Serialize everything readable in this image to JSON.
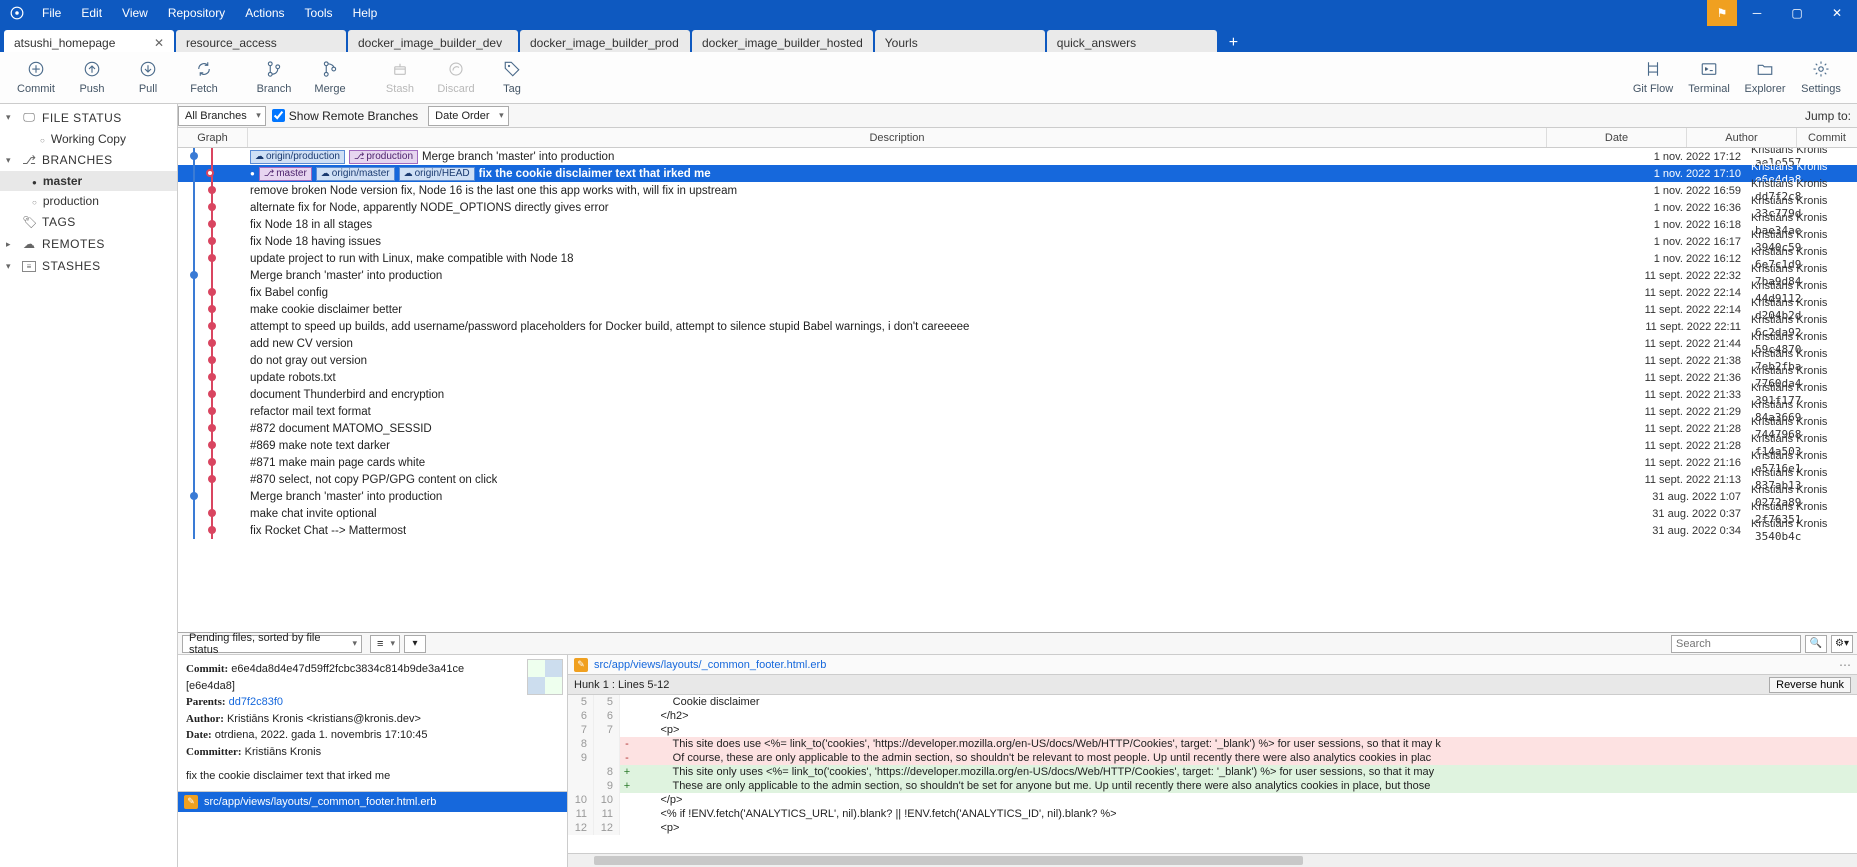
{
  "menu": [
    "File",
    "Edit",
    "View",
    "Repository",
    "Actions",
    "Tools",
    "Help"
  ],
  "tabs": [
    {
      "label": "atsushi_homepage",
      "active": true,
      "closable": true
    },
    {
      "label": "resource_access"
    },
    {
      "label": "docker_image_builder_dev"
    },
    {
      "label": "docker_image_builder_prod"
    },
    {
      "label": "docker_image_builder_hosted"
    },
    {
      "label": "Yourls"
    },
    {
      "label": "quick_answers"
    }
  ],
  "toolbar": [
    {
      "name": "commit",
      "label": "Commit",
      "icon": "plus"
    },
    {
      "name": "push",
      "label": "Push",
      "icon": "up"
    },
    {
      "name": "pull",
      "label": "Pull",
      "icon": "down"
    },
    {
      "name": "fetch",
      "label": "Fetch",
      "icon": "refresh"
    },
    {
      "sep": true
    },
    {
      "name": "branch",
      "label": "Branch",
      "icon": "branch"
    },
    {
      "name": "merge",
      "label": "Merge",
      "icon": "merge"
    },
    {
      "sep": true
    },
    {
      "name": "stash",
      "label": "Stash",
      "icon": "stash",
      "disabled": true
    },
    {
      "name": "discard",
      "label": "Discard",
      "icon": "discard",
      "disabled": true
    },
    {
      "name": "tag",
      "label": "Tag",
      "icon": "tag"
    }
  ],
  "toolbar_right": [
    {
      "name": "gitflow",
      "label": "Git Flow",
      "icon": "flow"
    },
    {
      "name": "terminal",
      "label": "Terminal",
      "icon": "term"
    },
    {
      "name": "explorer",
      "label": "Explorer",
      "icon": "folder"
    },
    {
      "name": "settings",
      "label": "Settings",
      "icon": "gear"
    }
  ],
  "secbar": {
    "branches": "All Branches",
    "show_remote_label": "Show Remote Branches",
    "date_order": "Date Order",
    "jump": "Jump to:"
  },
  "columns": {
    "graph": "Graph",
    "desc": "Description",
    "date": "Date",
    "author": "Author",
    "commit": "Commit"
  },
  "sidebar": {
    "file_status": {
      "title": "FILE STATUS",
      "items": [
        "Working Copy"
      ]
    },
    "branches": {
      "title": "BRANCHES",
      "items": [
        {
          "label": "master",
          "active": true
        },
        {
          "label": "production"
        }
      ]
    },
    "tags": {
      "title": "TAGS"
    },
    "remotes": {
      "title": "REMOTES"
    },
    "stashes": {
      "title": "STASHES"
    }
  },
  "commits": [
    {
      "badges": [
        {
          "t": "remote",
          "l": "origin/production"
        },
        {
          "t": "local",
          "l": "production"
        }
      ],
      "desc": "Merge branch 'master' into production",
      "date": "1 nov. 2022 17:12",
      "author": "Kristiāns Kronis <k",
      "hash": "ae1e557",
      "merge": true
    },
    {
      "selected": true,
      "badges": [
        {
          "t": "local",
          "l": "master",
          "dot": true
        },
        {
          "t": "remote",
          "l": "origin/master"
        },
        {
          "t": "remote",
          "l": "origin/HEAD"
        }
      ],
      "desc": "fix the cookie disclaimer text that irked me",
      "date": "1 nov. 2022 17:10",
      "author": "Kristiāns Kronis <k",
      "hash": "e6e4da8"
    },
    {
      "desc": "remove broken Node version fix, Node 16 is the last one this app works with, will fix in upstream",
      "date": "1 nov. 2022 16:59",
      "author": "Kristiāns Kronis <k",
      "hash": "dd7f2c8"
    },
    {
      "desc": "alternate fix for Node, apparently NODE_OPTIONS directly gives error",
      "date": "1 nov. 2022 16:36",
      "author": "Kristiāns Kronis <k",
      "hash": "33c779d"
    },
    {
      "desc": "fix Node 18 in all stages",
      "date": "1 nov. 2022 16:18",
      "author": "Kristiāns Kronis <k",
      "hash": "bae34ae"
    },
    {
      "desc": "fix Node 18 having issues",
      "date": "1 nov. 2022 16:17",
      "author": "Kristiāns Kronis <k",
      "hash": "3940c59"
    },
    {
      "desc": "update project to run with Linux, make compatible with Node 18",
      "date": "1 nov. 2022 16:12",
      "author": "Kristiāns Kronis <k",
      "hash": "6e7c1d9"
    },
    {
      "desc": "Merge branch 'master' into production",
      "date": "11 sept. 2022 22:32",
      "author": "Kristiāns Kronis <k",
      "hash": "7ba9d84",
      "merge": true
    },
    {
      "desc": "fix Babel config",
      "date": "11 sept. 2022 22:14",
      "author": "Kristiāns Kronis <k",
      "hash": "44d9112"
    },
    {
      "desc": "make cookie disclaimer better",
      "date": "11 sept. 2022 22:14",
      "author": "Kristiāns Kronis <k",
      "hash": "d204b2d"
    },
    {
      "desc": "attempt to speed up builds, add username/password placeholders for Docker build, attempt to silence stupid Babel warnings, i don't careeeee",
      "date": "11 sept. 2022 22:11",
      "author": "Kristiāns Kronis <k",
      "hash": "6c2da92"
    },
    {
      "desc": "add new CV version",
      "date": "11 sept. 2022 21:44",
      "author": "Kristiāns Kronis <k",
      "hash": "59c4870"
    },
    {
      "desc": "do not gray out version",
      "date": "11 sept. 2022 21:38",
      "author": "Kristiāns Kronis <k",
      "hash": "7eb2fba"
    },
    {
      "desc": "update robots.txt",
      "date": "11 sept. 2022 21:36",
      "author": "Kristiāns Kronis <k",
      "hash": "7760da4"
    },
    {
      "desc": "document Thunderbird and encryption",
      "date": "11 sept. 2022 21:33",
      "author": "Kristiāns Kronis <k",
      "hash": "391f177"
    },
    {
      "desc": "refactor mail text format",
      "date": "11 sept. 2022 21:29",
      "author": "Kristiāns Kronis <k",
      "hash": "84a3669"
    },
    {
      "desc": "#872 document MATOMO_SESSID",
      "date": "11 sept. 2022 21:28",
      "author": "Kristiāns Kronis <k",
      "hash": "7447968"
    },
    {
      "desc": "#869 make note text darker",
      "date": "11 sept. 2022 21:28",
      "author": "Kristiāns Kronis <k",
      "hash": "f14a503"
    },
    {
      "desc": "#871 make main page cards white",
      "date": "11 sept. 2022 21:16",
      "author": "Kristiāns Kronis <k",
      "hash": "e5716e1"
    },
    {
      "desc": "#870 select, not copy PGP/GPG content on click",
      "date": "11 sept. 2022 21:13",
      "author": "Kristiāns Kronis <k",
      "hash": "837ab13"
    },
    {
      "desc": "Merge branch 'master' into production",
      "date": "31 aug. 2022 1:07",
      "author": "Kristiāns Kronis <k",
      "hash": "0272a89",
      "merge": true
    },
    {
      "desc": "make chat invite optional",
      "date": "31 aug. 2022 0:37",
      "author": "Kristiāns Kronis <k",
      "hash": "2f76351"
    },
    {
      "desc": "fix Rocket Chat --> Mattermost",
      "date": "31 aug. 2022 0:34",
      "author": "Kristiāns Kronis <k",
      "hash": "3540b4c"
    }
  ],
  "detail": {
    "pending_label": "Pending files, sorted by file status",
    "commit_label": "Commit:",
    "commit_value": "e6e4da8d4e47d59ff2fcbc3834c814b9de3a41ce [e6e4da8]",
    "parents_label": "Parents:",
    "parents_value": "dd7f2c83f0",
    "author_label": "Author:",
    "author_value": "Kristiāns Kronis <kristians@kronis.dev>",
    "date_label": "Date:",
    "date_value": "otrdiena, 2022. gada 1. novembris 17:10:45",
    "committer_label": "Committer:",
    "committer_value": "Kristiāns Kronis",
    "message": "fix the cookie disclaimer text that irked me",
    "file_path": "src/app/views/layouts/_common_footer.html.erb",
    "hunk_label": "Hunk 1 : Lines 5-12",
    "reverse_label": "Reverse hunk",
    "search_placeholder": "Search"
  },
  "diff": [
    {
      "a": "5",
      "b": "5",
      "t": " ",
      "c": "            Cookie disclaimer"
    },
    {
      "a": "6",
      "b": "6",
      "t": " ",
      "c": "        </h2>"
    },
    {
      "a": "7",
      "b": "7",
      "t": " ",
      "c": "        <p>"
    },
    {
      "a": "8",
      "b": "",
      "t": "-",
      "c": "            This site does use <%= link_to('cookies', 'https://developer.mozilla.org/en-US/docs/Web/HTTP/Cookies', target: '_blank') %> for user sessions, so that it may k"
    },
    {
      "a": "9",
      "b": "",
      "t": "-",
      "c": "            Of course, these are only applicable to the admin section, so shouldn't be relevant to most people. Up until recently there were also analytics cookies in plac"
    },
    {
      "a": "",
      "b": "8",
      "t": "+",
      "c": "            This site only uses <%= link_to('cookies', 'https://developer.mozilla.org/en-US/docs/Web/HTTP/Cookies', target: '_blank') %> for user sessions, so that it may"
    },
    {
      "a": "",
      "b": "9",
      "t": "+",
      "c": "            These are only applicable to the admin section, so shouldn't be set for anyone but me. Up until recently there were also analytics cookies in place, but those"
    },
    {
      "a": "10",
      "b": "10",
      "t": " ",
      "c": "        </p>"
    },
    {
      "a": "11",
      "b": "11",
      "t": " ",
      "c": "        <% if !ENV.fetch('ANALYTICS_URL', nil).blank? || !ENV.fetch('ANALYTICS_ID', nil).blank? %>"
    },
    {
      "a": "12",
      "b": "12",
      "t": " ",
      "c": "        <p>"
    }
  ]
}
